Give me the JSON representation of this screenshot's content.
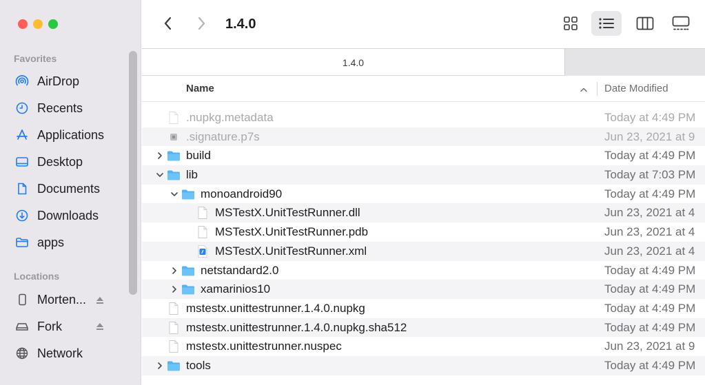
{
  "window": {
    "title": "1.4.0",
    "tab_label": "1.4.0",
    "traffic_colors": [
      "#ff5f57",
      "#febc2e",
      "#28c840"
    ]
  },
  "sidebar": {
    "favorites_label": "Favorites",
    "favorites": [
      {
        "label": "AirDrop",
        "icon": "airdrop-icon"
      },
      {
        "label": "Recents",
        "icon": "clock-icon"
      },
      {
        "label": "Applications",
        "icon": "applications-icon"
      },
      {
        "label": "Desktop",
        "icon": "desktop-icon"
      },
      {
        "label": "Documents",
        "icon": "document-icon"
      },
      {
        "label": "Downloads",
        "icon": "download-icon"
      },
      {
        "label": "apps",
        "icon": "folder-icon"
      }
    ],
    "locations_label": "Locations",
    "locations": [
      {
        "label": "Morten...",
        "icon": "phone-icon",
        "ejectable": true
      },
      {
        "label": "Fork",
        "icon": "drive-icon",
        "ejectable": true
      },
      {
        "label": "Network",
        "icon": "network-icon",
        "ejectable": false
      }
    ],
    "accent_color": "#1e7cf6"
  },
  "columns": {
    "name": "Name",
    "date_modified": "Date Modified"
  },
  "files": [
    {
      "name": ".nupkg.metadata",
      "date": "Today at 4:49 PM",
      "kind": "file",
      "depth": 0,
      "dim": true
    },
    {
      "name": ".signature.p7s",
      "date": "Jun 23, 2021 at 9",
      "kind": "cert",
      "depth": 0,
      "dim": true
    },
    {
      "name": "build",
      "date": "Today at 4:49 PM",
      "kind": "folder",
      "depth": 0,
      "expanded": false
    },
    {
      "name": "lib",
      "date": "Today at 7:03 PM",
      "kind": "folder",
      "depth": 0,
      "expanded": true
    },
    {
      "name": "monoandroid90",
      "date": "Today at 4:49 PM",
      "kind": "folder",
      "depth": 1,
      "expanded": true
    },
    {
      "name": "MSTestX.UnitTestRunner.dll",
      "date": "Jun 23, 2021 at 4",
      "kind": "file",
      "depth": 2
    },
    {
      "name": "MSTestX.UnitTestRunner.pdb",
      "date": "Jun 23, 2021 at 4",
      "kind": "file",
      "depth": 2
    },
    {
      "name": "MSTestX.UnitTestRunner.xml",
      "date": "Jun 23, 2021 at 4",
      "kind": "xml",
      "depth": 2
    },
    {
      "name": "netstandard2.0",
      "date": "Today at 4:49 PM",
      "kind": "folder",
      "depth": 1,
      "expanded": false
    },
    {
      "name": "xamarinios10",
      "date": "Today at 4:49 PM",
      "kind": "folder",
      "depth": 1,
      "expanded": false
    },
    {
      "name": "mstestx.unittestrunner.1.4.0.nupkg",
      "date": "Today at 4:49 PM",
      "kind": "file",
      "depth": 0
    },
    {
      "name": "mstestx.unittestrunner.1.4.0.nupkg.sha512",
      "date": "Today at 4:49 PM",
      "kind": "file",
      "depth": 0
    },
    {
      "name": "mstestx.unittestrunner.nuspec",
      "date": "Jun 23, 2021 at 9",
      "kind": "file",
      "depth": 0
    },
    {
      "name": "tools",
      "date": "Today at 4:49 PM",
      "kind": "folder",
      "depth": 0,
      "expanded": false
    }
  ]
}
